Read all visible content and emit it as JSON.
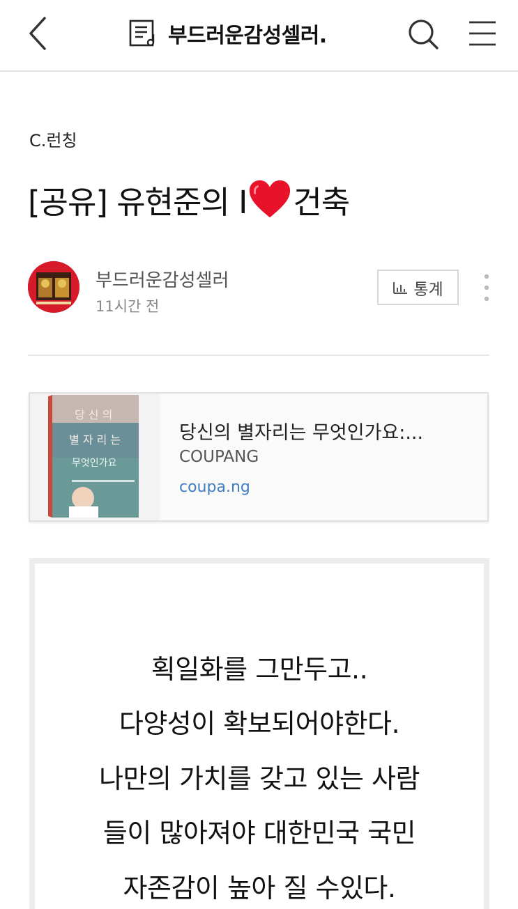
{
  "header": {
    "blog_title": "부드러운감성셀러.",
    "icons": [
      "back-icon",
      "blog-doc-icon",
      "search-icon",
      "menu-icon"
    ]
  },
  "post": {
    "category": "C.런칭",
    "title_before": "[공유] 유현준의 I",
    "title_after": "건축",
    "author": "부드러운감성셀러",
    "time": "11시간 전",
    "stats_label": "통계"
  },
  "link_card": {
    "title": "당신의 별자리는 무엇인가요:...",
    "source": "COUPANG",
    "url": "coupa.ng"
  },
  "quote": {
    "lines": [
      "획일화를 그만두고..",
      "다양성이 확보되어야한다.",
      "나만의 가치를 갖고 있는 사람",
      "들이 많아져야 대한민국 국민",
      "자존감이 높아 질 수있다."
    ]
  },
  "colors": {
    "heart": "#e8132a",
    "link": "#3f7fbf",
    "avatar": "#d71a2a"
  }
}
